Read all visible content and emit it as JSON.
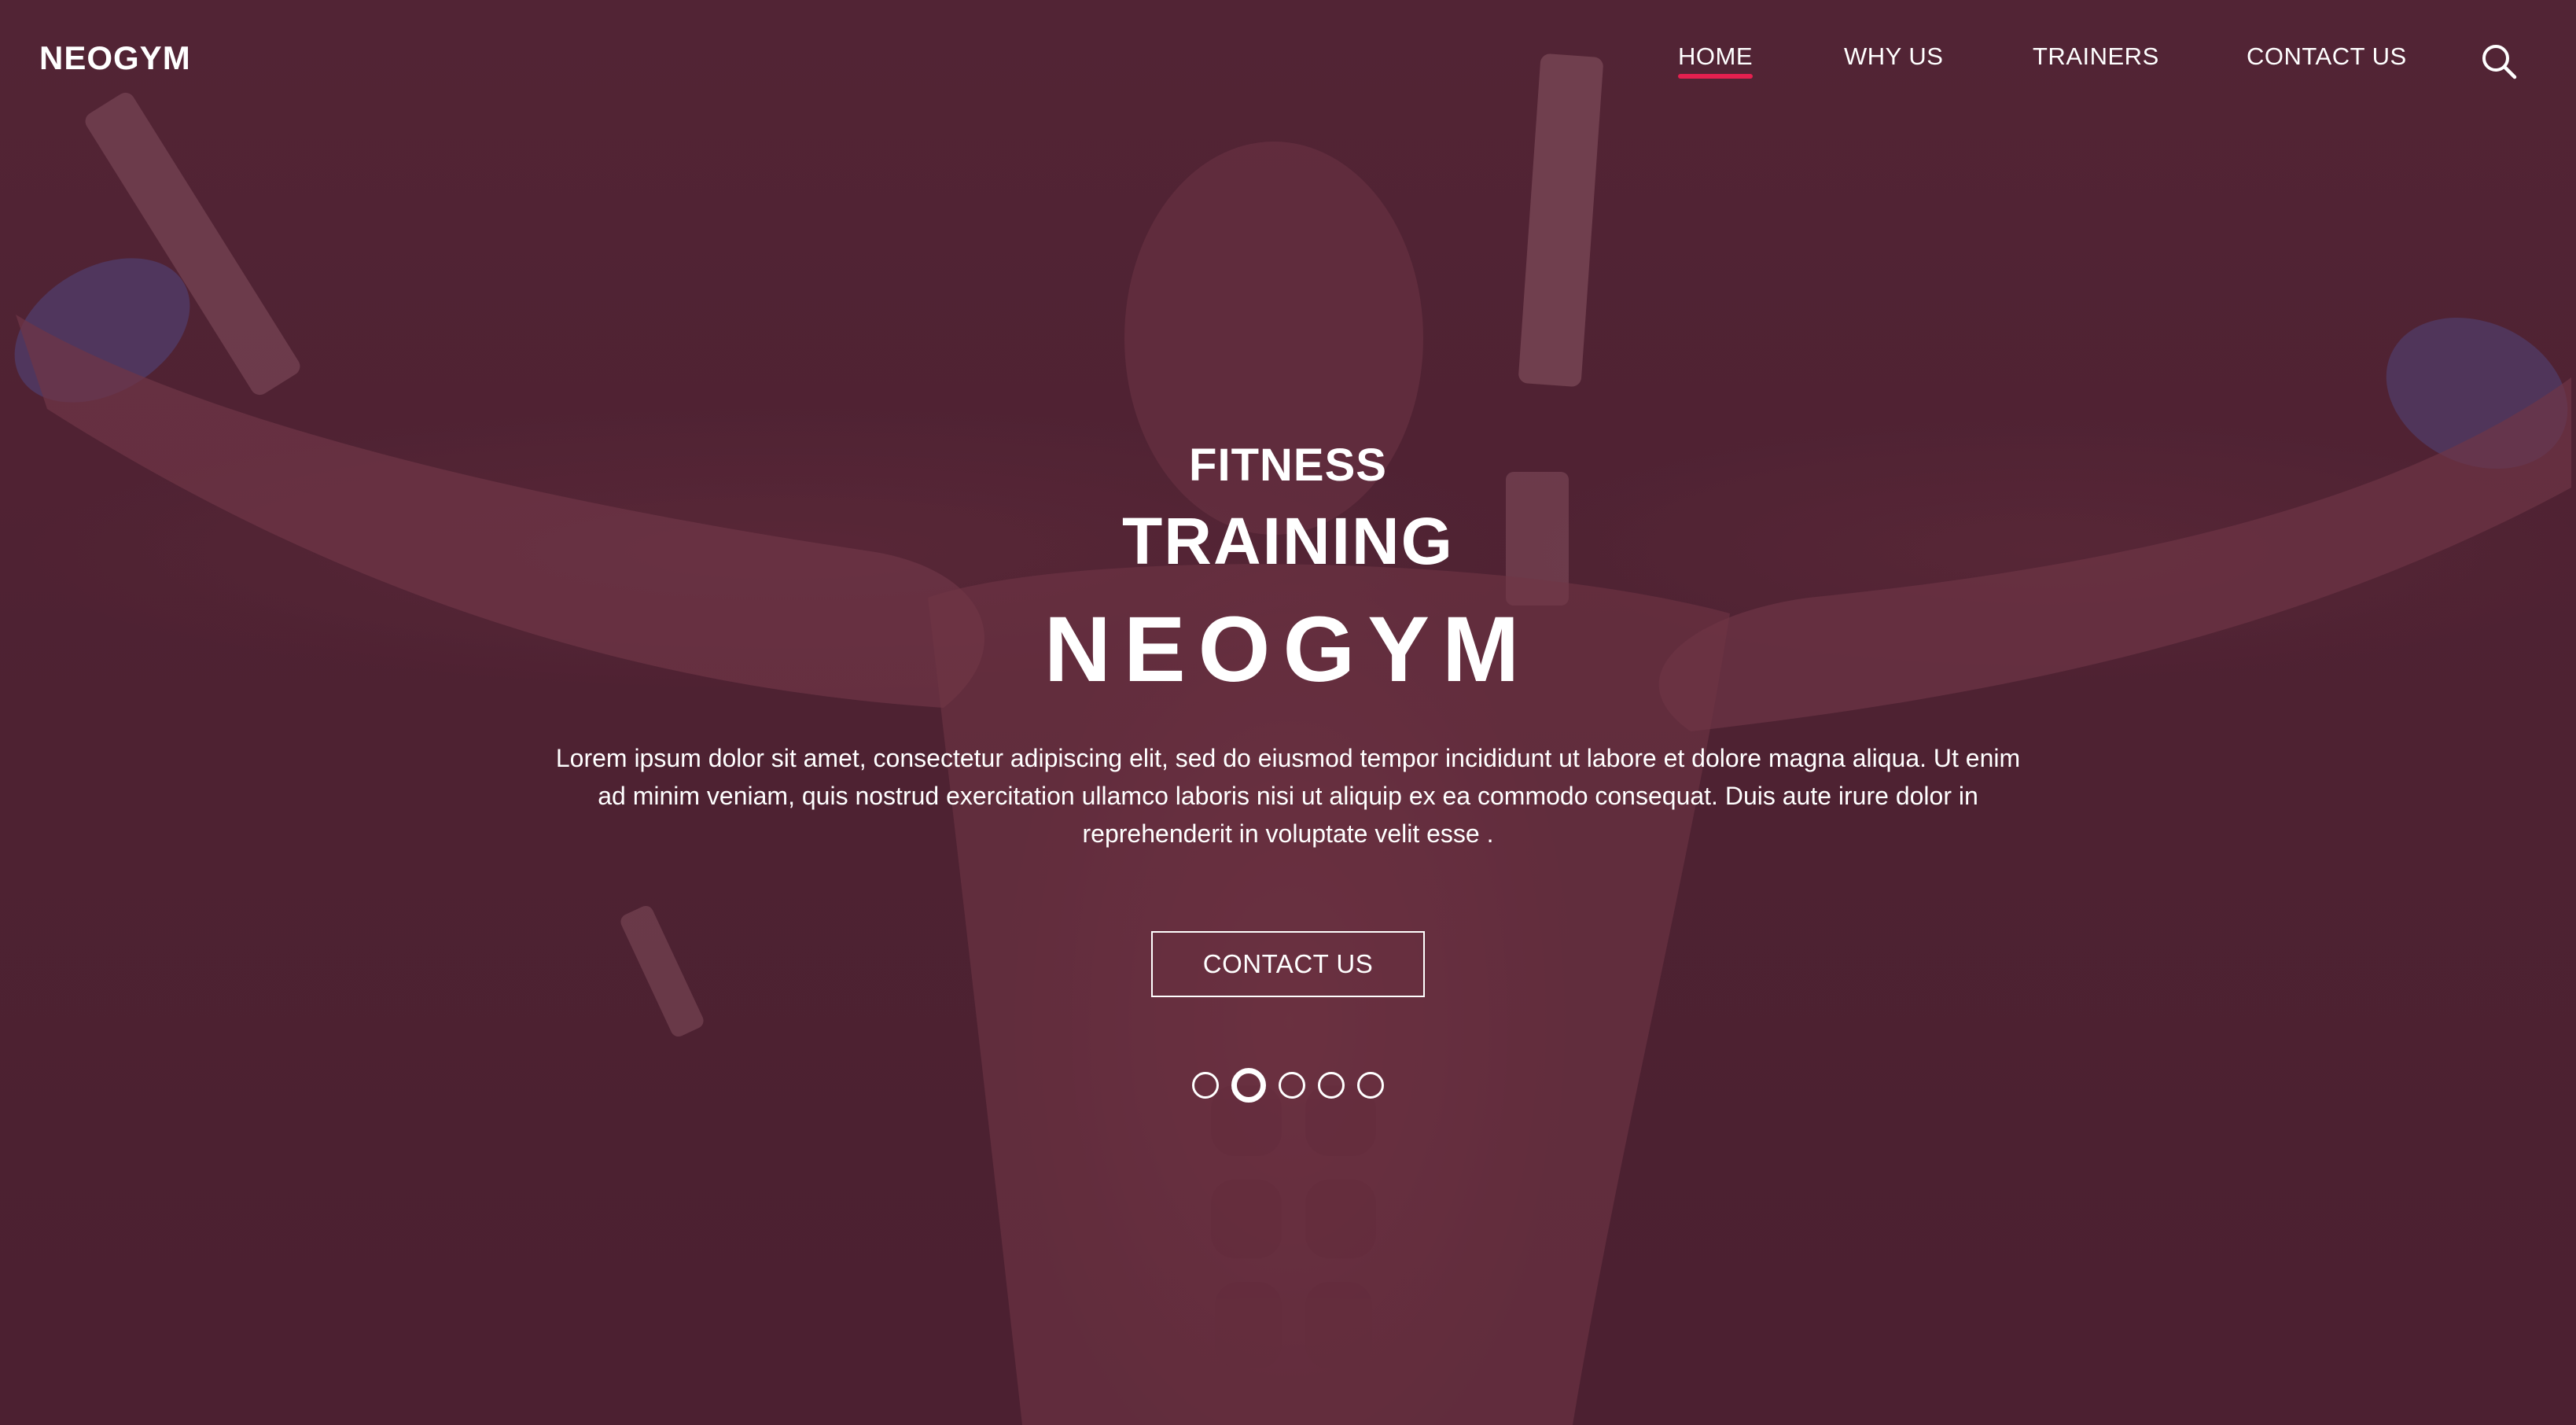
{
  "nav": {
    "brand": "NEOGYM",
    "items": [
      {
        "label": "HOME",
        "active": true
      },
      {
        "label": "WHY US",
        "active": false
      },
      {
        "label": "TRAINERS",
        "active": false
      },
      {
        "label": "CONTACT US",
        "active": false
      }
    ],
    "search_icon": "search-icon",
    "active_color": "#e5204f"
  },
  "hero": {
    "kicker": "FITNESS",
    "title": "TRAINING",
    "brand_title": "NEOGYM",
    "description": "Lorem ipsum dolor sit amet, consectetur adipiscing elit, sed do eiusmod tempor incididunt ut labore et dolore magna aliqua. Ut enim ad minim veniam, quis nostrud exercitation ullamco laboris nisi ut aliquip ex ea commodo consequat. Duis aute irure dolor in reprehenderit in voluptate velit esse .",
    "cta_label": "CONTACT US",
    "overlay_color": "#4f2333"
  },
  "carousel": {
    "total_slides": 5,
    "active_index": 1
  }
}
